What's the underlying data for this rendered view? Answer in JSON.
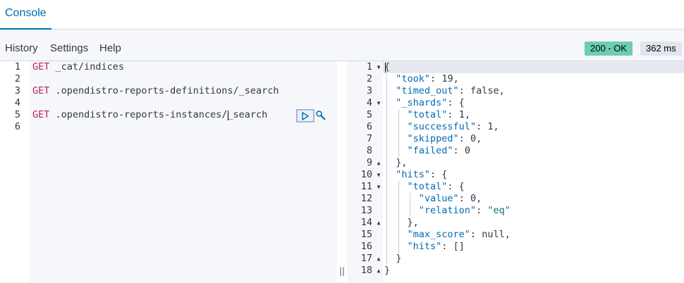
{
  "tabs": {
    "console": "Console"
  },
  "menu": {
    "history": "History",
    "settings": "Settings",
    "help": "Help"
  },
  "status": {
    "code": "200 - OK",
    "time": "362 ms"
  },
  "request_editor": {
    "line_numbers": [
      "1",
      "2",
      "3",
      "4",
      "5",
      "6"
    ],
    "lines": [
      {
        "method": "GET",
        "path": " _cat/indices"
      },
      {
        "method": "",
        "path": ""
      },
      {
        "method": "GET",
        "path": " .opendistro-reports-definitions/_search"
      },
      {
        "method": "",
        "path": ""
      },
      {
        "method": "GET",
        "path": " .opendistro-reports-instances/_search"
      },
      {
        "method": "",
        "path": ""
      }
    ],
    "run_icon": "play-icon",
    "wrench_icon": "wrench-icon"
  },
  "response": {
    "line_numbers": [
      "1",
      "2",
      "3",
      "4",
      "5",
      "6",
      "7",
      "8",
      "9",
      "10",
      "11",
      "12",
      "13",
      "14",
      "15",
      "16",
      "17",
      "18"
    ],
    "json": {
      "open": "{",
      "took_key": "\"took\"",
      "took_val": "19",
      "timed_out_key": "\"timed_out\"",
      "timed_out_val": "false",
      "shards_key": "\"_shards\"",
      "total_key": "\"total\"",
      "total_val": "1",
      "successful_key": "\"successful\"",
      "successful_val": "1",
      "skipped_key": "\"skipped\"",
      "skipped_val": "0",
      "failed_key": "\"failed\"",
      "failed_val": "0",
      "hits_key": "\"hits\"",
      "hits_total_key": "\"total\"",
      "value_key": "\"value\"",
      "value_val": "0",
      "relation_key": "\"relation\"",
      "relation_val": "\"eq\"",
      "max_score_key": "\"max_score\"",
      "max_score_val": "null",
      "inner_hits_key": "\"hits\"",
      "inner_hits_val": "[]",
      "close": "}"
    }
  },
  "icons": {
    "resizer": "drag-handle-icon",
    "fold_open": "fold-open-icon",
    "fold_close": "fold-close-icon"
  }
}
